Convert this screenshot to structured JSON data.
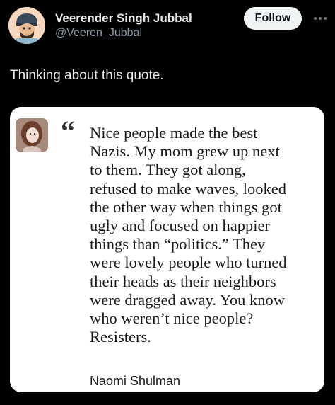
{
  "tweet": {
    "author": {
      "display_name": "Veerender Singh Jubbal",
      "handle": "@Veeren_Jubbal"
    },
    "follow_label": "Follow",
    "more_icon": "more-horizontal-icon",
    "text": "Thinking about this quote.",
    "quote": {
      "lines": [
        "Nice people made the best",
        "Nazis. My mom grew up next",
        "to them. They got along,",
        "refused to make waves, looked",
        "the other way when things got",
        "ugly and focused on happier",
        "things than “politics.” They",
        "were lovely people who turned",
        "their heads as their neighbors",
        "were dragged away. You know",
        "who weren’t nice people?",
        "Resisters."
      ],
      "author": "Naomi Shulman",
      "quote_icon": "opening-quote-icon"
    }
  },
  "colors": {
    "background": "#000000",
    "primary_text": "#e7e9ea",
    "secondary_text": "#8b98a5",
    "follow_button_bg": "#eff3f4",
    "card_bg": "#ffffff"
  }
}
